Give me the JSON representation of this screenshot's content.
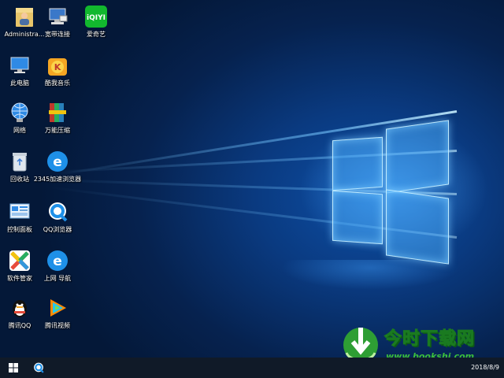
{
  "desktop": {
    "icons": [
      {
        "label": "Administra...",
        "icon": "user-folder-icon"
      },
      {
        "label": "宽带连接",
        "icon": "network-connection-icon"
      },
      {
        "label": "爱奇艺",
        "icon": "iqiyi-icon"
      },
      {
        "label": "此电脑",
        "icon": "computer-icon"
      },
      {
        "label": "酷我音乐",
        "icon": "kuwo-music-icon"
      },
      {
        "label": "网络",
        "icon": "network-icon"
      },
      {
        "label": "万能压缩",
        "icon": "archive-icon"
      },
      {
        "label": "回收站",
        "icon": "recycle-bin-icon"
      },
      {
        "label": "2345加速浏览器",
        "icon": "browser-2345-icon"
      },
      {
        "label": "控制面板",
        "icon": "control-panel-icon"
      },
      {
        "label": "QQ浏览器",
        "icon": "qq-browser-icon"
      },
      {
        "label": "软件管家",
        "icon": "software-manager-icon"
      },
      {
        "label": "上网 导航",
        "icon": "ie-navigation-icon"
      },
      {
        "label": "腾讯QQ",
        "icon": "qq-penguin-icon"
      },
      {
        "label": "腾讯视频",
        "icon": "tencent-video-icon"
      }
    ]
  },
  "watermark": {
    "title": "今时下载网",
    "url": "www.bookshi.com"
  },
  "taskbar": {
    "clock_date": "2018/8/9",
    "start_icon": "windows-logo-icon",
    "pinned_app_icon": "qq-browser-icon"
  },
  "colors": {
    "accent_blue": "#1e88e5",
    "taskbar": "#101a28",
    "watermark_green": "#2e9e34"
  }
}
